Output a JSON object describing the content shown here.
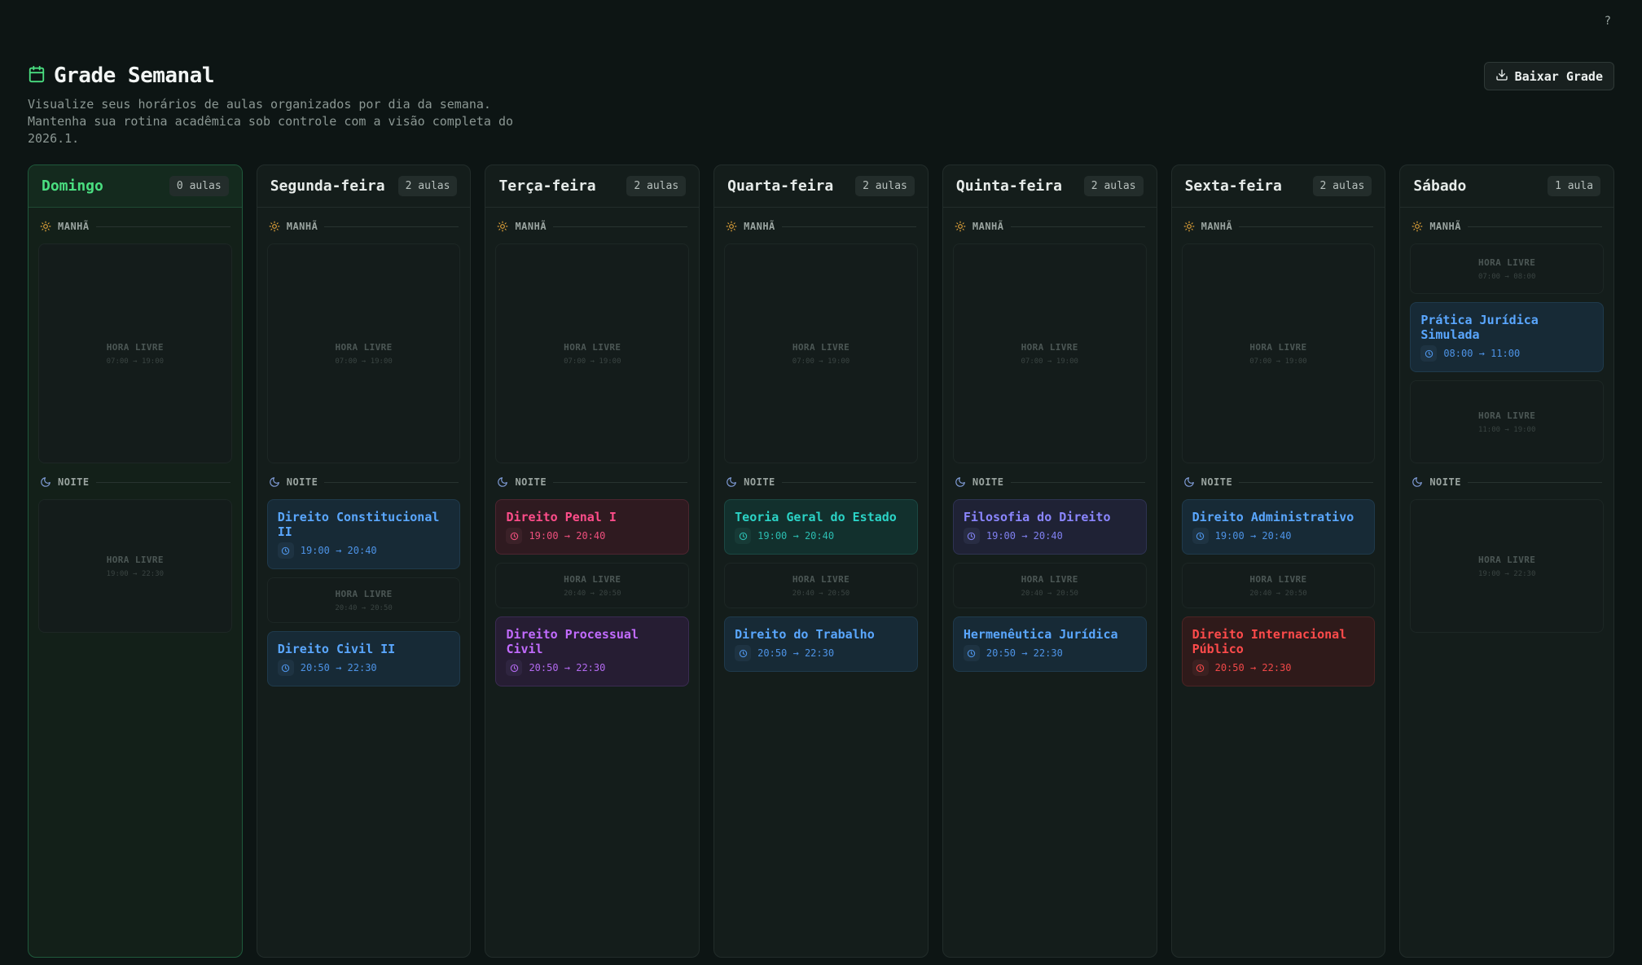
{
  "help": {
    "label": "?"
  },
  "header": {
    "title": "Grade Semanal",
    "subtitle": "Visualize seus horários de aulas organizados por dia da semana. Mantenha sua rotina acadêmica sob controle com a visão completa do 2026.1.",
    "download_label": "Baixar Grade"
  },
  "periods": {
    "morning": "MANHÃ",
    "night": "NOITE"
  },
  "free_label": "HORA LIVRE",
  "colors": {
    "accent_green": "#4ade80",
    "blue": "#5aa7ff",
    "red": "#ff4d8a",
    "purple": "#c26bff",
    "teal": "#2bd3c6",
    "indigo": "#8b86ff",
    "scarlet": "#ff4b4b"
  },
  "days": [
    {
      "name": "Domingo",
      "badge": "0 aulas",
      "active": true,
      "morning": [
        {
          "type": "free",
          "time": "07:00 → 19:00"
        }
      ],
      "night": [
        {
          "type": "free",
          "time": "19:00 → 22:30"
        }
      ]
    },
    {
      "name": "Segunda-feira",
      "badge": "2 aulas",
      "morning": [
        {
          "type": "free",
          "time": "07:00 → 19:00"
        }
      ],
      "night": [
        {
          "type": "class",
          "name": "Direito Constitucional II",
          "time": "19:00 → 20:40",
          "color": "blue"
        },
        {
          "type": "free",
          "time": "20:40 → 20:50"
        },
        {
          "type": "class",
          "name": "Direito Civil II",
          "time": "20:50 → 22:30",
          "color": "blue"
        }
      ]
    },
    {
      "name": "Terça-feira",
      "badge": "2 aulas",
      "morning": [
        {
          "type": "free",
          "time": "07:00 → 19:00"
        }
      ],
      "night": [
        {
          "type": "class",
          "name": "Direito Penal I",
          "time": "19:00 → 20:40",
          "color": "red"
        },
        {
          "type": "free",
          "time": "20:40 → 20:50"
        },
        {
          "type": "class",
          "name": "Direito Processual Civil",
          "time": "20:50 → 22:30",
          "color": "purple"
        }
      ]
    },
    {
      "name": "Quarta-feira",
      "badge": "2 aulas",
      "morning": [
        {
          "type": "free",
          "time": "07:00 → 19:00"
        }
      ],
      "night": [
        {
          "type": "class",
          "name": "Teoria Geral do Estado",
          "time": "19:00 → 20:40",
          "color": "teal"
        },
        {
          "type": "free",
          "time": "20:40 → 20:50"
        },
        {
          "type": "class",
          "name": "Direito do Trabalho",
          "time": "20:50 → 22:30",
          "color": "blue"
        }
      ]
    },
    {
      "name": "Quinta-feira",
      "badge": "2 aulas",
      "morning": [
        {
          "type": "free",
          "time": "07:00 → 19:00"
        }
      ],
      "night": [
        {
          "type": "class",
          "name": "Filosofia do Direito",
          "time": "19:00 → 20:40",
          "color": "indigo"
        },
        {
          "type": "free",
          "time": "20:40 → 20:50"
        },
        {
          "type": "class",
          "name": "Hermenêutica Jurídica",
          "time": "20:50 → 22:30",
          "color": "blue"
        }
      ]
    },
    {
      "name": "Sexta-feira",
      "badge": "2 aulas",
      "morning": [
        {
          "type": "free",
          "time": "07:00 → 19:00"
        }
      ],
      "night": [
        {
          "type": "class",
          "name": "Direito Administrativo",
          "time": "19:00 → 20:40",
          "color": "blue"
        },
        {
          "type": "free",
          "time": "20:40 → 20:50"
        },
        {
          "type": "class",
          "name": "Direito Internacional Público",
          "time": "20:50 → 22:30",
          "color": "scarlet"
        }
      ]
    },
    {
      "name": "Sábado",
      "badge": "1 aula",
      "morning": [
        {
          "type": "free",
          "time": "07:00 → 08:00"
        },
        {
          "type": "class",
          "name": "Prática Jurídica Simulada",
          "time": "08:00 → 11:00",
          "color": "blue"
        },
        {
          "type": "free",
          "time": "11:00 → 19:00"
        }
      ],
      "night": [
        {
          "type": "free",
          "time": "19:00 → 22:30"
        }
      ]
    }
  ]
}
